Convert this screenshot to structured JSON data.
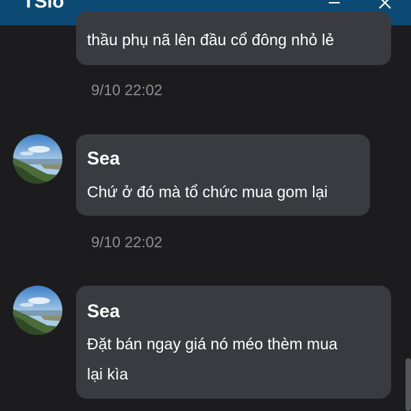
{
  "window": {
    "title": "TSlò",
    "minimize_icon": "minimize-icon",
    "close_icon": "close-icon"
  },
  "colors": {
    "titlebar": "#0d4a73",
    "background": "#1c1c1f",
    "bubble": "#3a3a41",
    "timestamp": "#8d8d94"
  },
  "messages": [
    {
      "text": "thầu phụ nã lên đầu cổ đông nhỏ lẻ",
      "timestamp": "9/10 22:02"
    },
    {
      "sender": "Sea",
      "avatar": "landscape-avatar",
      "text": "Chứ ở đó mà tổ chức mua gom lại",
      "timestamp": "9/10 22:02"
    },
    {
      "sender": "Sea",
      "avatar": "landscape-avatar",
      "text_line1": "Đặt bán ngay giá nó méo thèm mua",
      "text_line2": "lại kìa"
    }
  ]
}
